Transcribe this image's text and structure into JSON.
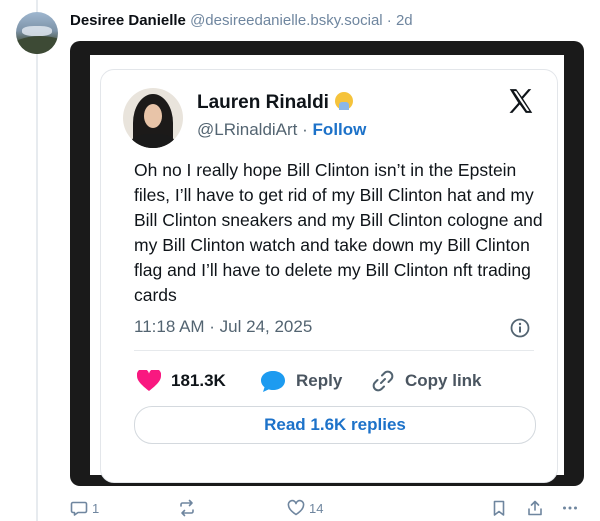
{
  "post": {
    "author_name": "Desiree Danielle",
    "author_handle": "@desireedanielle.bsky.social",
    "separator": "·",
    "age": "2d",
    "reply_count": "1",
    "like_count": "14"
  },
  "tweet": {
    "name": "Lauren Rinaldi",
    "handle": "@LRinaldiArt",
    "separator": "·",
    "follow_label": "Follow",
    "text": "Oh no I really hope Bill Clinton isn’t in the Epstein files, I’ll have to get rid of my Bill Clinton hat and my Bill Clinton sneakers and my Bill Clinton cologne and my Bill Clinton watch and take down my Bill Clinton flag and I’ll have to delete my Bill Clinton nft trading cards",
    "timestamp": "11:18 AM · Jul 24, 2025",
    "likes": "181.3K",
    "reply_label": "Reply",
    "copy_link_label": "Copy link",
    "read_replies_label": "Read 1.6K replies"
  },
  "colors": {
    "heart": "#f91880",
    "reply_bubble": "#1d9bf0",
    "follow": "#1d72c9",
    "muted": "#6f869f"
  }
}
